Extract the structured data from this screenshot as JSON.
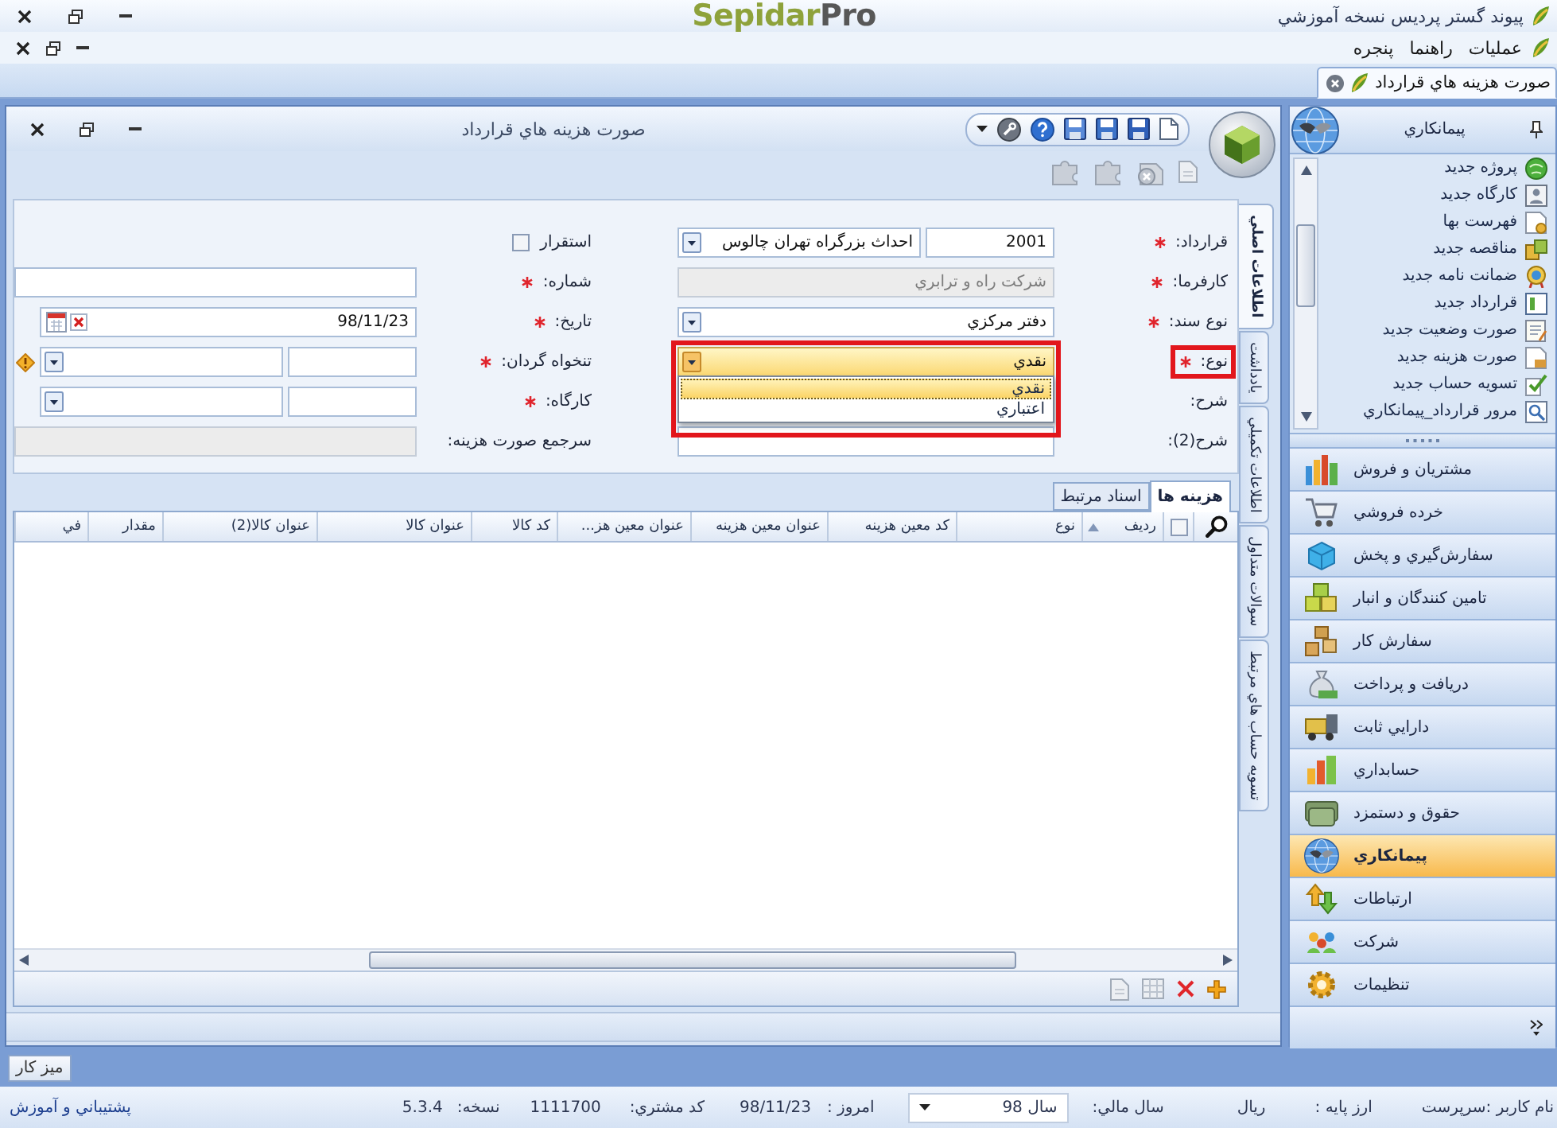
{
  "title_bar": {
    "title": "پيوند گستر پرديس نسخه آموزشي",
    "logo_primary": "Sepidar",
    "logo_secondary": "Pro"
  },
  "menu_bar": {
    "items": [
      "عمليات",
      "راهنما",
      "پنجره"
    ]
  },
  "document_tabs": [
    {
      "label": "صورت هزينه هاي قرارداد",
      "selected": true
    }
  ],
  "form_window": {
    "title": "صورت هزينه هاي قرارداد",
    "side_tabs": [
      {
        "label": "اطلاعات اصلي",
        "selected": true
      },
      {
        "label": "يادداشت",
        "selected": false
      },
      {
        "label": "اطلاعات تكميلي",
        "selected": false
      },
      {
        "label": "سوالات متداول",
        "selected": false
      },
      {
        "label": "تسويه حساب هاي مرتبط",
        "selected": false
      }
    ],
    "field_rows": [
      [
        {
          "kind": "code_combo",
          "label": "قرارداد:",
          "required": true,
          "highlighted": false,
          "code": "2001",
          "value": "احداث بزرگراه تهران چالوس"
        },
        {
          "kind": "checkbox",
          "label": "استقرار",
          "checked": false
        }
      ],
      [
        {
          "kind": "text",
          "label": "كارفرما:",
          "required": true,
          "highlighted": false,
          "disabled": true,
          "value": "شركت راه و ترابري"
        },
        {
          "kind": "text",
          "label": "شماره:",
          "required": true,
          "highlighted": false,
          "disabled": false
        }
      ],
      [
        {
          "kind": "combo",
          "label": "نوع سند:",
          "required": true,
          "highlighted": false,
          "open": false,
          "value": "دفتر مركزي"
        },
        {
          "kind": "date",
          "label": "تاريخ:",
          "required": true,
          "highlighted": false,
          "value": "98/11/23"
        }
      ],
      [
        {
          "kind": "combo",
          "label": "نوع:",
          "required": true,
          "highlighted": true,
          "open": true,
          "value": "نقدي",
          "options": [
            {
              "label": "نقدي",
              "selected": true
            },
            {
              "label": "اعتباري",
              "selected": false
            }
          ]
        },
        {
          "kind": "pair_combo",
          "label": "تنخواه گردان:",
          "required": true,
          "highlighted": false,
          "alert": true
        }
      ],
      [
        {
          "kind": "label",
          "label": "شرح:",
          "required": false,
          "highlighted": false
        },
        {
          "kind": "pair_combo",
          "label": "كارگاه:",
          "required": true,
          "highlighted": false,
          "alert": false
        }
      ],
      [
        {
          "kind": "text",
          "label": "شرح(2):",
          "required": false,
          "highlighted": false,
          "disabled": false
        },
        {
          "kind": "text",
          "label": "سرجمع صورت هزينه:",
          "required": false,
          "highlighted": false,
          "disabled": true
        }
      ]
    ],
    "grid_tabs": [
      {
        "label": "هزينه ها",
        "selected": true
      },
      {
        "label": "اسناد مرتبط",
        "selected": false
      }
    ],
    "grid": {
      "select_all_checked": false,
      "columns": [
        {
          "label": "رديف",
          "sorted": true
        },
        {
          "label": "نوع",
          "sorted": false
        },
        {
          "label": "كد معين هزينه",
          "sorted": false
        },
        {
          "label": "عنوان معين هزينه",
          "sorted": false
        },
        {
          "label": "عنوان معين هز...",
          "sorted": false
        },
        {
          "label": "كد كالا",
          "sorted": false
        },
        {
          "label": "عنوان كالا",
          "sorted": false
        },
        {
          "label": "عنوان كالا(2)",
          "sorted": false
        },
        {
          "label": "مقدار",
          "sorted": false
        },
        {
          "label": "في",
          "sorted": false
        }
      ]
    }
  },
  "sidebar": {
    "title": "پيمانكاري",
    "tasks": [
      "پروژه جديد",
      "كارگاه جديد",
      "فهرست بها",
      "مناقصه جديد",
      "ضمانت نامه جديد",
      "قرارداد جديد",
      "صورت وضعيت جديد",
      "صورت هزينه جديد",
      "تسويه حساب جديد",
      "مرور قرارداد_پيمانكاري"
    ],
    "modules": [
      {
        "label": "مشتريان و فروش",
        "selected": false
      },
      {
        "label": "خرده فروشي",
        "selected": false
      },
      {
        "label": "سفارش‌گيري و پخش",
        "selected": false
      },
      {
        "label": "تامين كنندگان و انبار",
        "selected": false
      },
      {
        "label": "سفارش كار",
        "selected": false
      },
      {
        "label": "دريافت و پرداخت",
        "selected": false
      },
      {
        "label": "دارايي ثابت",
        "selected": false
      },
      {
        "label": "حسابداري",
        "selected": false
      },
      {
        "label": "حقوق و دستمزد",
        "selected": false
      },
      {
        "label": "پيمانكاري",
        "selected": true
      },
      {
        "label": "ارتباطات",
        "selected": false
      },
      {
        "label": "شركت",
        "selected": false
      },
      {
        "label": "تنظيمات",
        "selected": false
      }
    ]
  },
  "taskbar": {
    "button": "ميز كار"
  },
  "status_bar": {
    "user": "نام كاربر :سرپرست",
    "fields": [
      {
        "kind": "text",
        "label": "ارز پايه :",
        "value": "ريال"
      },
      {
        "kind": "dropdown",
        "label": "سال مالي:",
        "value": "سال 98"
      },
      {
        "kind": "text",
        "label": "امروز :",
        "value": "98/11/23"
      },
      {
        "kind": "text",
        "label": "كد مشتري:",
        "value": "1111700"
      },
      {
        "kind": "text",
        "label": "نسخه:",
        "value": "5.3.4"
      }
    ],
    "support_link": "پشتيباني و آموزش"
  }
}
